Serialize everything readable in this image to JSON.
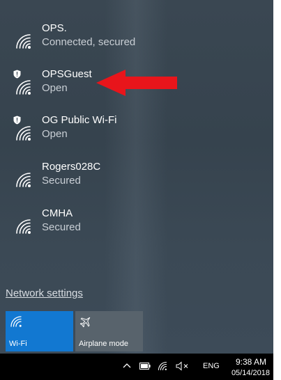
{
  "networks": [
    {
      "name": "OPS.",
      "status": "Connected, secured",
      "shield": false
    },
    {
      "name": "OPSGuest",
      "status": "Open",
      "shield": true
    },
    {
      "name": "OG Public Wi-Fi",
      "status": "Open",
      "shield": true
    },
    {
      "name": "Rogers028C",
      "status": "Secured",
      "shield": false
    },
    {
      "name": "CMHA",
      "status": "Secured",
      "shield": false
    }
  ],
  "network_settings_label": "Network settings",
  "tiles": {
    "wifi": {
      "label": "Wi-Fi",
      "icon": "wifi-icon",
      "state": "on"
    },
    "airplane": {
      "label": "Airplane mode",
      "icon": "airplane-icon",
      "state": "off"
    }
  },
  "taskbar": {
    "language": "ENG",
    "time": "9:38 AM",
    "date": "05/14/2018",
    "tray_icons": [
      "chevron-up-icon",
      "battery-icon",
      "wifi-icon",
      "volume-muted-icon"
    ]
  },
  "colors": {
    "accent": "#1278d1",
    "arrow": "#e8151b"
  }
}
